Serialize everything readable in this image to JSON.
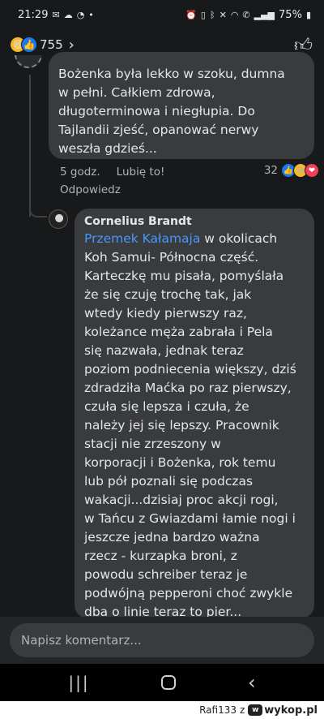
{
  "status_bar": {
    "time": "21:29",
    "dot": "•",
    "battery": "75%"
  },
  "header": {
    "reaction_count": "755"
  },
  "comment1": {
    "lines": [
      "Bożenka była lekko w szoku, dumna",
      "w pełni. Całkiem zdrowa,",
      "długoterminowa i niegłupia. Do",
      "Tajlandii zjeść, opanować nerwy",
      "weszła gdzieś..."
    ],
    "time": "5 godz.",
    "like_label": "Lubię to!",
    "reply_label": "Odpowiedz",
    "reaction_count": "32"
  },
  "comment2": {
    "author": "Cornelius Brandt",
    "mention": "Przemek Kałamaja",
    "lines": [
      " w okolicach",
      "Koh Samui- Północna część.",
      "Karteczkę mu pisała, pomyślała",
      "że się czuję trochę tak, jak",
      "wtedy kiedy pierwszy raz,",
      "koleżance męża zabrała i Pela",
      "się nazwała, jednak teraz",
      "poziom podniecenia większy, dziś",
      "zdradziła Maćka po raz pierwszy,",
      "czuła się lepsza i czuła, że",
      "należy jej się lepszy. Pracownik",
      "stacji nie zrzeszony w",
      "korporacji i Bożenka, rok temu",
      "lub pół poznali się podczas",
      "wakacji...dzisiaj proc akcji rogi,",
      "w Tańcu z Gwiazdami łamie nogi i",
      "jeszcze jedna bardzo ważna",
      "rzecz - kurzapka broni, z",
      "powodu schreiber teraz je",
      "podwójną pepperoni choć zwykle",
      "dba o linie teraz to pier..."
    ]
  },
  "composer": {
    "placeholder": "Napisz komentarz..."
  },
  "watermark": {
    "user": "Rafi133",
    "z": "z",
    "site": "wykop.pl"
  },
  "colors": {
    "background": "#18191a",
    "bubble": "#3a3b3c",
    "mention": "#4599ff",
    "like": "#1877f2"
  }
}
